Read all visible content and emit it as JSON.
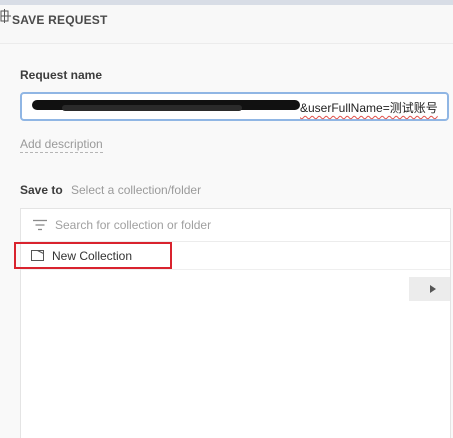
{
  "header": {
    "title": "SAVE REQUEST",
    "drag_icon": "drag-handle-icon"
  },
  "form": {
    "request_name_label": "Request name",
    "request_name_visible_tail": "&userFullName=测试账号",
    "add_description": "Add description",
    "save_to_label": "Save to",
    "save_to_hint": "Select a collection/folder"
  },
  "browser": {
    "search_placeholder": "Search for collection or folder",
    "filter_icon": "filter-icon",
    "items": [
      {
        "label": "New Collection",
        "icon": "collection-icon"
      }
    ],
    "expand_icon": "chevron-right-icon"
  },
  "colors": {
    "focus_border": "#90b6e4",
    "highlight": "#d9232e",
    "spell_error": "#e0504a"
  }
}
